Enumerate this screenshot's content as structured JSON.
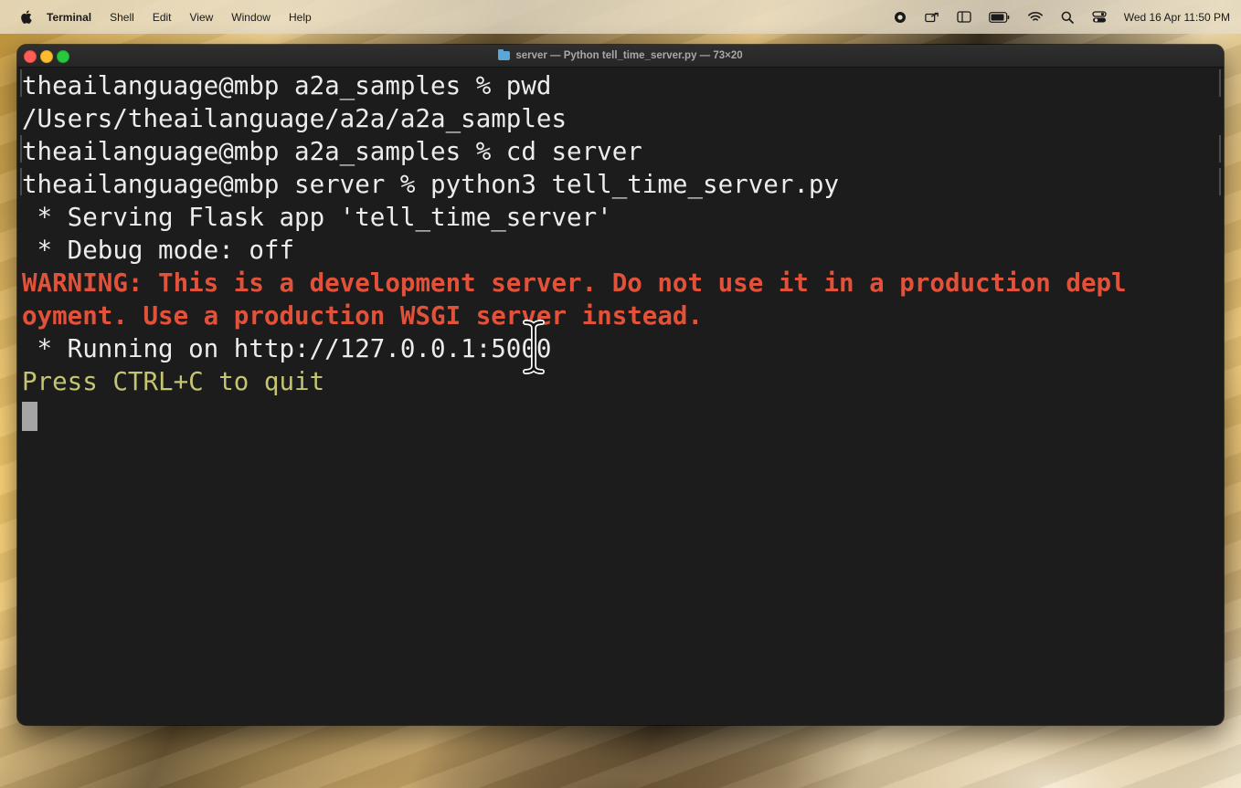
{
  "menubar": {
    "app_name": "Terminal",
    "items": [
      "Shell",
      "Edit",
      "View",
      "Window",
      "Help"
    ],
    "clock": "Wed 16 Apr  11:50 PM",
    "status_icons": [
      "record-icon",
      "screen-share-icon",
      "sidebar-icon",
      "battery-icon",
      "wifi-icon",
      "search-icon",
      "control-center-icon"
    ]
  },
  "window": {
    "title": "server — Python tell_time_server.py — 73×20",
    "title_icon": "folder-icon"
  },
  "terminal": {
    "lines": [
      "theailanguage@mbp a2a_samples % pwd",
      "/Users/theailanguage/a2a/a2a_samples",
      "theailanguage@mbp a2a_samples % cd server",
      "theailanguage@mbp server % python3 tell_time_server.py",
      " * Serving Flask app 'tell_time_server'",
      " * Debug mode: off",
      "WARNING: This is a development server. Do not use it in a production depl",
      "oyment. Use a production WSGI server instead.",
      " * Running on http://127.0.0.1:5000",
      "Press CTRL+C to quit"
    ]
  },
  "colors": {
    "terminal_bg": "#1c1c1c",
    "terminal_text": "#ececec",
    "warning_text": "#e2523a",
    "hint_text": "#c4c472"
  }
}
